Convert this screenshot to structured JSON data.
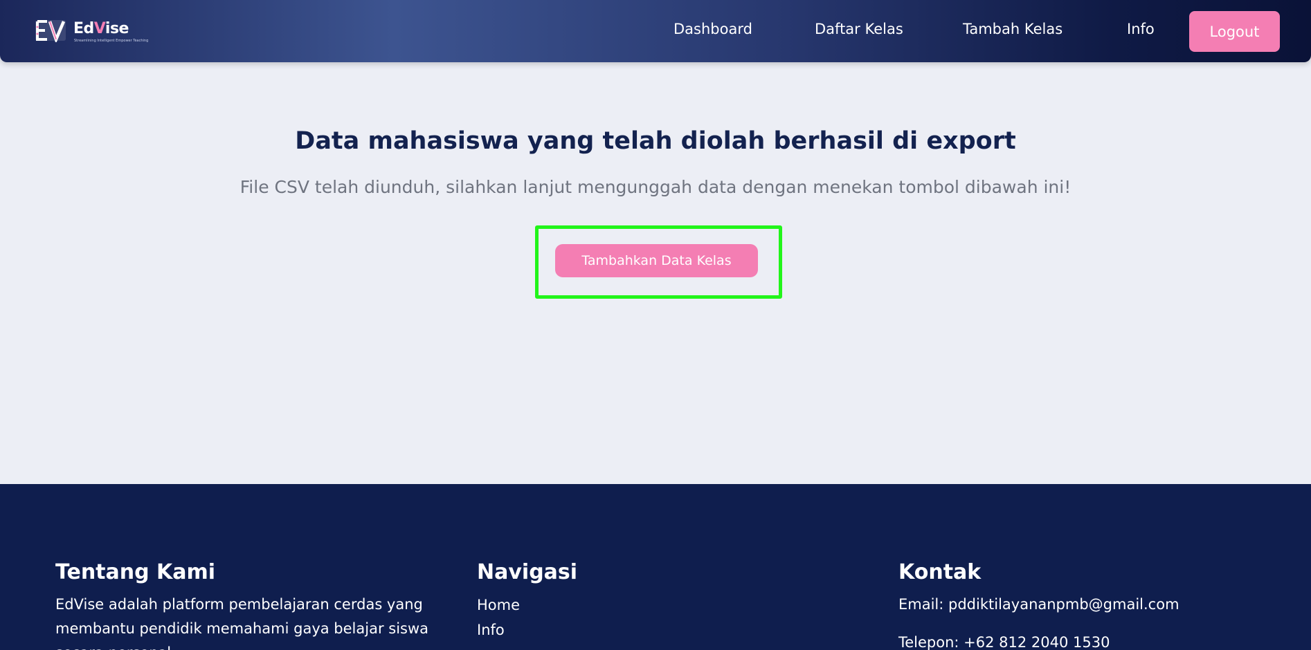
{
  "brand": {
    "name_part1": "Ed",
    "name_part2": "V",
    "name_part3": "ise",
    "tagline": "Streamlining Intelligent Empower Teaching",
    "accent_color": "#f47eb3"
  },
  "navbar": {
    "links": [
      "Dashboard",
      "Daftar Kelas",
      "Tambah Kelas",
      "Info"
    ],
    "logout_label": "Logout"
  },
  "main": {
    "title": "Data mahasiswa yang telah diolah berhasil di export",
    "subtitle": "File CSV telah diunduh, silahkan lanjut mengunggah data dengan menekan tombol dibawah ini!",
    "button_label": "Tambahkan Data Kelas",
    "highlight_color": "#22f51a"
  },
  "footer": {
    "about": {
      "heading": "Tentang Kami",
      "text": "EdVise adalah platform pembelajaran cerdas yang membantu pendidik memahami gaya belajar siswa secara personal."
    },
    "navigation": {
      "heading": "Navigasi",
      "links": [
        "Home",
        "Info"
      ]
    },
    "contact": {
      "heading": "Kontak",
      "email": "Email: pddiktilayananpmb@gmail.com",
      "phone": "Telepon: +62 812 2040 1530"
    }
  }
}
